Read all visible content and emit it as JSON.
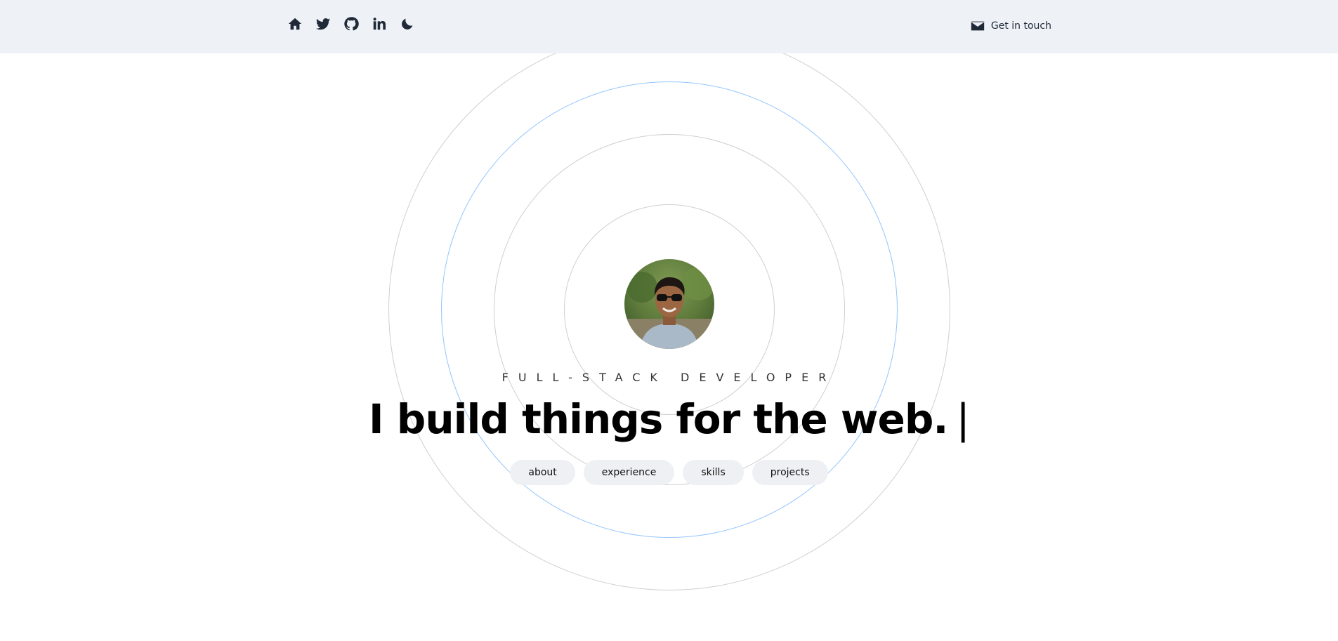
{
  "header": {
    "nav_icons": [
      "home-icon",
      "twitter-icon",
      "github-icon",
      "linkedin-icon",
      "moon-icon"
    ],
    "contact_label": "Get in touch"
  },
  "hero": {
    "role": "FULL-STACK DEVELOPER",
    "headline": "I build things for the web.",
    "cursor": "|"
  },
  "pills": [
    {
      "label": "about"
    },
    {
      "label": "experience"
    },
    {
      "label": "skills"
    },
    {
      "label": "projects"
    }
  ],
  "colors": {
    "header_bg": "#eef2f7",
    "accent_ring": "#93c5fd",
    "ring": "#cfcfcf",
    "pill_bg": "#eef0f3"
  }
}
